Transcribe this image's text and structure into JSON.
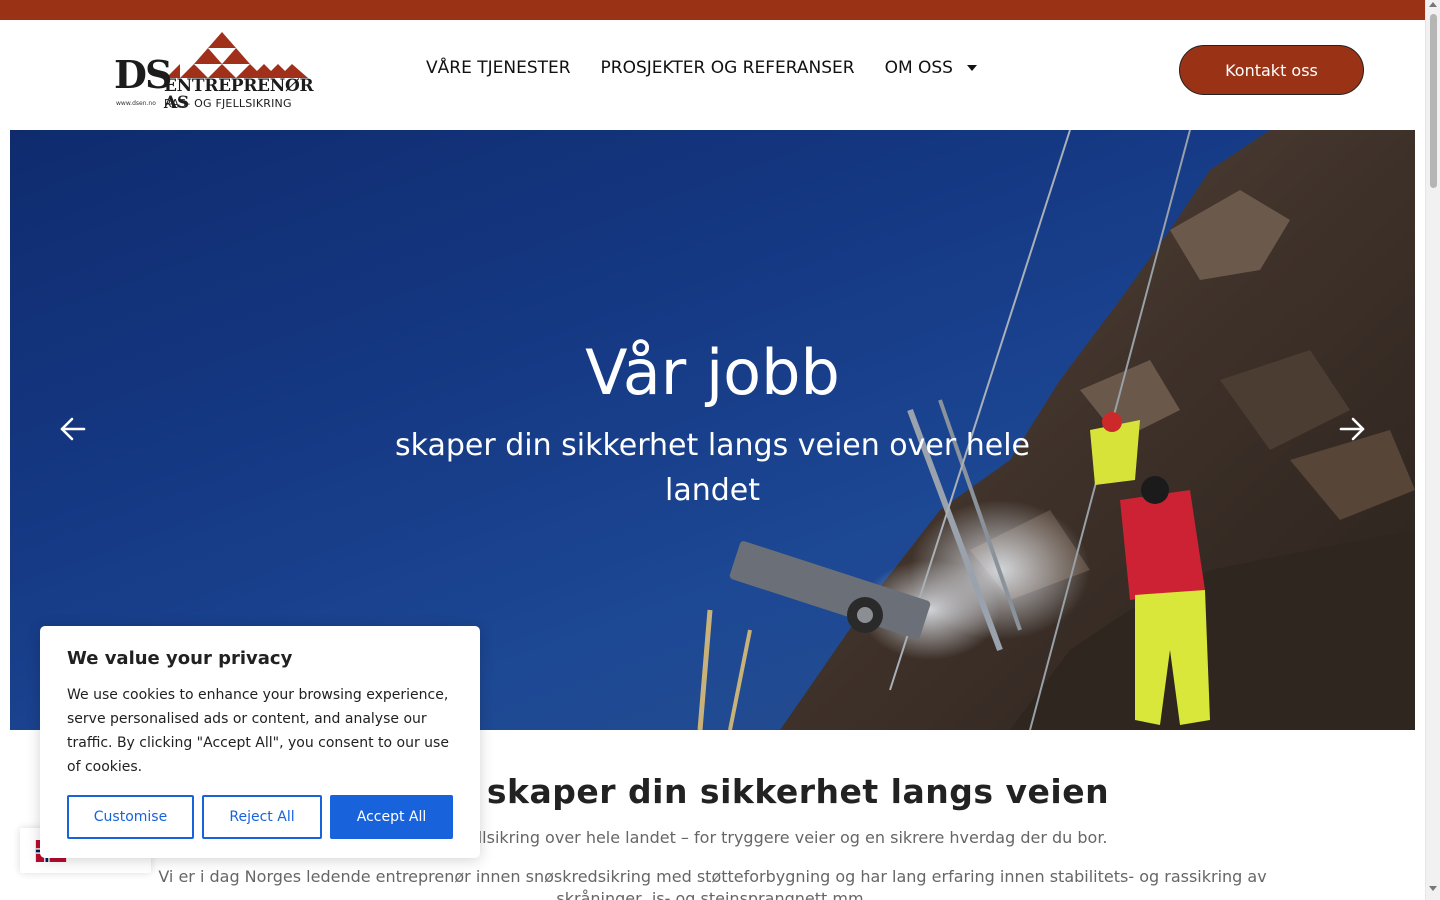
{
  "brand": {
    "logo_main": "DS",
    "logo_company": "ENTREPRENØR AS",
    "logo_tagline": "RAS- OG FJELLSIKRING",
    "logo_url_text": "www.dsen.no",
    "accent_color": "#9a3216"
  },
  "nav": {
    "items": [
      {
        "label": "VÅRE TJENESTER"
      },
      {
        "label": "PROSJEKTER OG REFERANSER"
      },
      {
        "label": "OM OSS",
        "icon": "caret-down-icon"
      }
    ],
    "cta_label": "Kontakt oss"
  },
  "hero": {
    "title": "Vår jobb",
    "subtitle": "skaper din sikkerhet langs veien over hele landet",
    "prev_icon": "arrow-left-icon",
    "next_icon": "arrow-right-icon"
  },
  "content": {
    "heading": "Vår jobb skaper din sikkerhet langs veien",
    "paragraph1": "Vi utfører ras- og fjellsikring over hele landet – for tryggere veier og en sikrere hverdag der du bor.",
    "paragraph2": "Vi er i dag Norges ledende entreprenør innen snøskredsikring med støtteforbygning og har lang erfaring innen stabilitets- og rassikring av skråninger, is- og steinsprangnett mm."
  },
  "cookie_banner": {
    "title": "We value your privacy",
    "text": "We use cookies to enhance your browsing experience, serve personalised ads or content, and analyse our traffic. By clicking \"Accept All\", you consent to our use of cookies.",
    "customise_label": "Customise",
    "reject_label": "Reject All",
    "accept_label": "Accept All",
    "button_color": "#1863dc"
  },
  "language_widget": {
    "icon": "norway-flag-icon"
  }
}
